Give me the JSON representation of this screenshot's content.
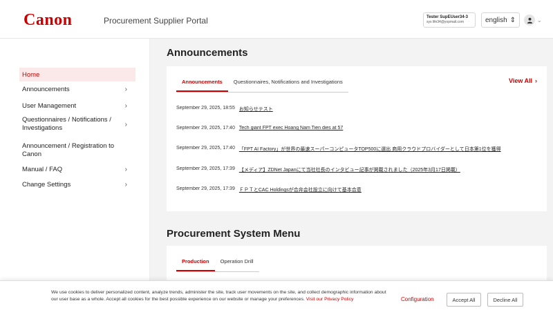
{
  "header": {
    "logo_text": "Canon",
    "portal_title": "Procurement Supplier Portal",
    "user_name": "Tester SupEUser34-3",
    "user_email": "sys life34@yopmail.com",
    "language": "english",
    "language_chevron": "⇕"
  },
  "sidebar": {
    "items": [
      {
        "label": "Home",
        "has_chevron": false
      },
      {
        "label": "Announcements",
        "has_chevron": true
      },
      {
        "label": "User Management",
        "has_chevron": true
      },
      {
        "label": "Questionnaires / Notifications / Investigations",
        "has_chevron": true
      },
      {
        "label": "Announcement / Registration to Canon",
        "has_chevron": false
      },
      {
        "label": "Manual / FAQ",
        "has_chevron": true
      },
      {
        "label": "Change Settings",
        "has_chevron": true
      }
    ],
    "chevron": "›"
  },
  "announcements_section": {
    "title": "Announcements",
    "tabs": [
      "Announcements",
      "Questionnaires, Notifications and Investigations"
    ],
    "view_all": "View All",
    "view_all_icon": "›",
    "items": [
      {
        "date": "September 29, 2025, 18:55",
        "title": "お知らせテスト"
      },
      {
        "date": "September 29, 2025, 17:40",
        "title": "Tech giant FPT exec Hoang Nam Tien dies at 57"
      },
      {
        "date": "September 29, 2025, 17:40",
        "title": "「FPT AI Factory」が世界の最速スーパーコンピュータTOP500に選出 商用クラウドプロバイダーとして日本第1位を獲得"
      },
      {
        "date": "September 29, 2025, 17:39",
        "title": "【メディア】ZDNet Japanにて当社社長のインタビュー記事が掲載されました（2025年3月17日掲載）"
      },
      {
        "date": "September 29, 2025, 17:39",
        "title": "ＦＰＴとCAC Holdingsが合弁会社設立に向けて基本合意"
      }
    ]
  },
  "procurement_section": {
    "title": "Procurement System Menu",
    "tabs": [
      "Production",
      "Operation Drill"
    ]
  },
  "cookie_banner": {
    "text": "We use cookies to deliver personalized content, analyze trends, administer the site, track user movements on the site, and collect demographic information about our user base as a whole. Accept all cookies for the best possible experience on our website or manage your preferences.",
    "policy_link": "Visit our Privacy Policy",
    "configuration": "Configuration",
    "accept_all": "Accept All",
    "decline_all": "Decline All"
  },
  "colors": {
    "brand": "#cc0000",
    "background": "#f3f3f3"
  },
  "icons": {
    "avatar": "user-avatar-icon",
    "avatar_glyph": "●",
    "avatar_chevron": "⌄"
  }
}
